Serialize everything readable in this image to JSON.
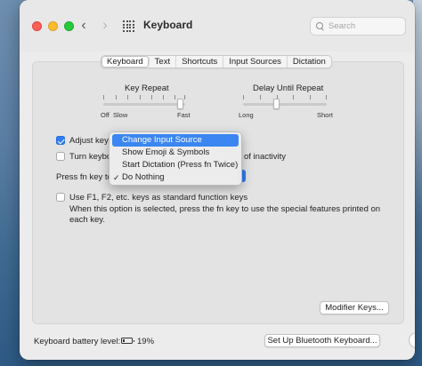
{
  "window": {
    "title": "Keyboard",
    "nav_back_glyph": "‹",
    "nav_forward_glyph": "›"
  },
  "search": {
    "placeholder": "Search"
  },
  "tabs": [
    {
      "label": "Keyboard",
      "active": true
    },
    {
      "label": "Text",
      "active": false
    },
    {
      "label": "Shortcuts",
      "active": false
    },
    {
      "label": "Input Sources",
      "active": false
    },
    {
      "label": "Dictation",
      "active": false
    }
  ],
  "key_repeat": {
    "label": "Key Repeat",
    "min_label": "Off",
    "slow_label": "Slow",
    "max_label": "Fast",
    "value_fraction": 0.94
  },
  "delay_until_repeat": {
    "label": "Delay Until Repeat",
    "min_label": "Long",
    "max_label": "Short",
    "value_fraction": 0.4
  },
  "options": {
    "adjust_brightness_label": "Adjust keyb",
    "adjust_brightness_checked": true,
    "turn_off_label": "Turn keybo",
    "turn_off_checked": false,
    "turn_off_suffix": "of inactivity",
    "press_fn_label": "Press fn key to"
  },
  "fn_menu": {
    "items": [
      {
        "label": "Change Input Source",
        "highlighted": true,
        "checked": false
      },
      {
        "label": "Show Emoji & Symbols",
        "highlighted": false,
        "checked": false
      },
      {
        "label": "Start Dictation (Press fn Twice)",
        "highlighted": false,
        "checked": false
      },
      {
        "label": "Do Nothing",
        "highlighted": false,
        "checked": true
      }
    ],
    "check_glyph": "✓"
  },
  "function_keys": {
    "label": "Use F1, F2, etc. keys as standard function keys",
    "checked": false,
    "description_line1": "When this option is selected, press the fn key to use the special features printed on",
    "description_line2": "each key."
  },
  "buttons": {
    "modifier_keys": "Modifier Keys...",
    "bluetooth_keyboard": "Set Up Bluetooth Keyboard...",
    "help": "?"
  },
  "battery": {
    "label": "Keyboard battery level:",
    "percent": "19%",
    "level_fraction": 0.19
  }
}
